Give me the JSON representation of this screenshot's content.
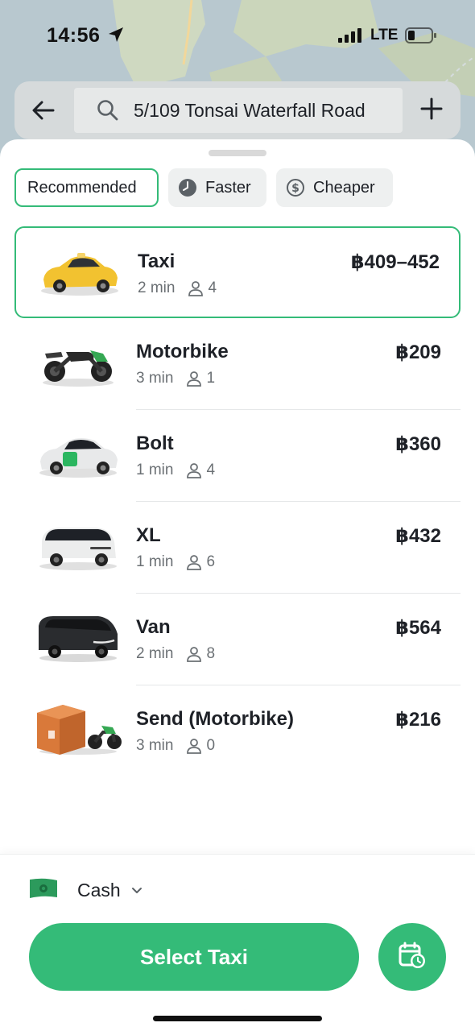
{
  "status_bar": {
    "time": "14:56",
    "network": "LTE"
  },
  "search": {
    "address": "5/109 Tonsai Waterfall Road"
  },
  "filters": [
    {
      "label": "Recommended",
      "active": true
    },
    {
      "label": "Faster",
      "icon": "clock-icon"
    },
    {
      "label": "Cheaper",
      "icon": "dollar-icon"
    }
  ],
  "options": [
    {
      "name": "Taxi",
      "eta": "2 min",
      "seats": "4",
      "price": "฿409–452",
      "selected": true
    },
    {
      "name": "Motorbike",
      "eta": "3 min",
      "seats": "1",
      "price": "฿209"
    },
    {
      "name": "Bolt",
      "eta": "1 min",
      "seats": "4",
      "price": "฿360"
    },
    {
      "name": "XL",
      "eta": "1 min",
      "seats": "6",
      "price": "฿432"
    },
    {
      "name": "Van",
      "eta": "2 min",
      "seats": "8",
      "price": "฿564"
    },
    {
      "name": "Send (Motorbike)",
      "eta": "3 min",
      "seats": "0",
      "price": "฿216"
    }
  ],
  "payment": {
    "method": "Cash"
  },
  "cta": {
    "label": "Select Taxi"
  },
  "colors": {
    "accent": "#34bb78",
    "taxi_yellow": "#f2c230"
  }
}
